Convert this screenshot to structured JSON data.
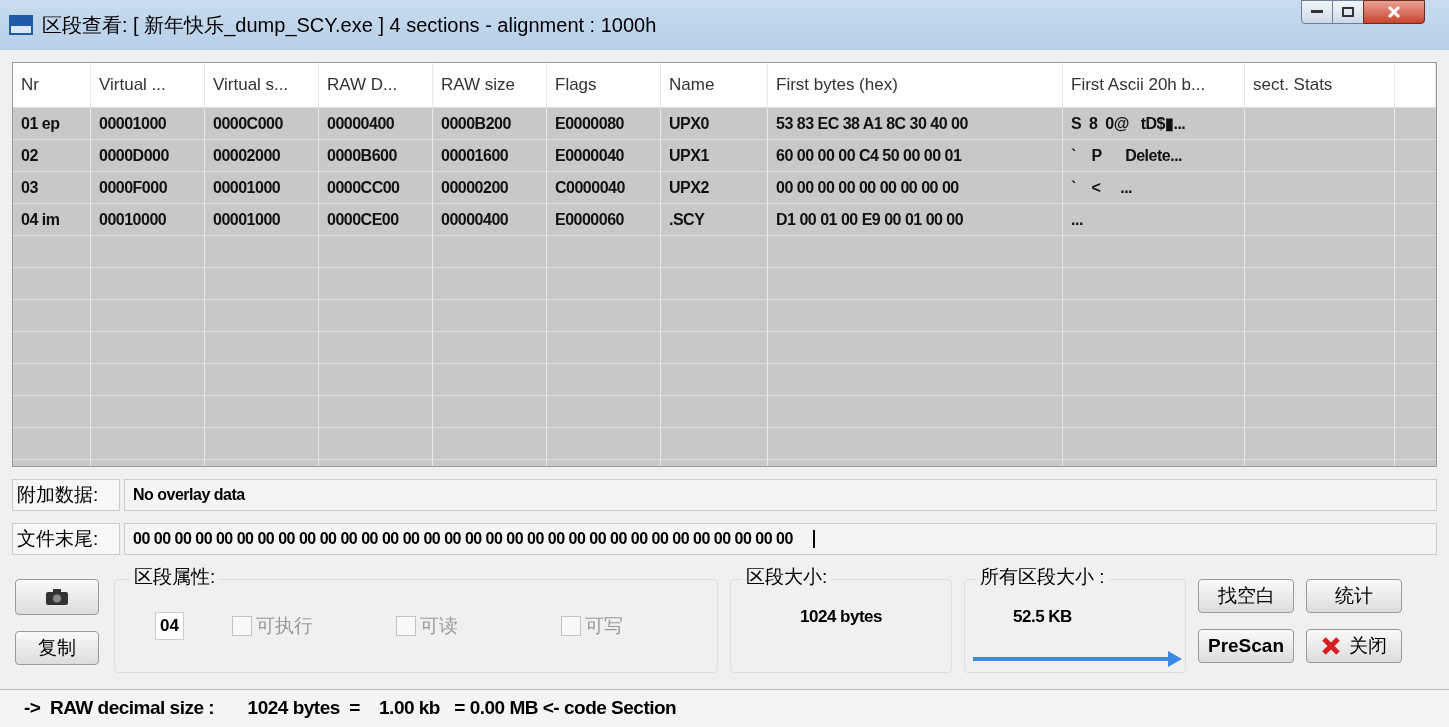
{
  "window": {
    "title": "区段查看: [ 新年快乐_dump_SCY.exe ] 4 sections - alignment : 1000h"
  },
  "table": {
    "columns": [
      "Nr",
      "Virtual ...",
      "Virtual s...",
      "RAW D...",
      "RAW size",
      "Flags",
      "Name",
      "First bytes (hex)",
      "First Ascii 20h b...",
      "sect. Stats"
    ],
    "rows": [
      [
        "01 ep",
        "00001000",
        "0000C000",
        "00000400",
        "0000B200",
        "E0000080",
        "UPX0",
        "53 83 EC 38 A1 8C 30 40 00",
        "S  8  0@   tD$▮..."
      ],
      [
        "02",
        "0000D000",
        "00002000",
        "0000B600",
        "00001600",
        "E0000040",
        "UPX1",
        "60 00 00 00 C4 50 00 00 01",
        "`    P      Delete..."
      ],
      [
        "03",
        "0000F000",
        "00001000",
        "0000CC00",
        "00000200",
        "C0000040",
        "UPX2",
        "00 00 00 00 00 00 00 00 00",
        "`    <     ..."
      ],
      [
        "04 im",
        "00010000",
        "00001000",
        "0000CE00",
        "00000400",
        "E0000060",
        ".SCY",
        "D1 00 01 00 E9 00 01 00 00",
        "..."
      ]
    ]
  },
  "overlay": {
    "label": "附加数据:",
    "value": "No overlay data"
  },
  "file_end": {
    "label": "文件末尾:",
    "value": "00 00 00 00 00 00 00 00 00 00 00 00 00 00 00 00 00 00 00 00 00 00 00 00 00 00 00 00 00 00 00 00"
  },
  "section_props": {
    "title": "区段属性:",
    "number": "04",
    "checkboxes": [
      {
        "label": "可执行",
        "checked": false
      },
      {
        "label": "可读",
        "checked": false
      },
      {
        "label": "可写",
        "checked": false
      }
    ]
  },
  "section_size": {
    "title": "区段大小:",
    "value": "1024 bytes"
  },
  "all_sections_size": {
    "title": "所有区段大小 :",
    "value": "52.5 KB"
  },
  "left_buttons": [
    "复制"
  ],
  "right_buttons": [
    {
      "label": "找空白",
      "kind": "plain"
    },
    {
      "label": "统计",
      "kind": "plain"
    },
    {
      "label": "PreScan",
      "kind": "bold"
    },
    {
      "label": "关闭",
      "kind": "close"
    }
  ],
  "status_bar": {
    "text": "->  RAW decimal size :       1024 bytes  =    1.00 kb   = 0.00 MB <- code Section"
  }
}
